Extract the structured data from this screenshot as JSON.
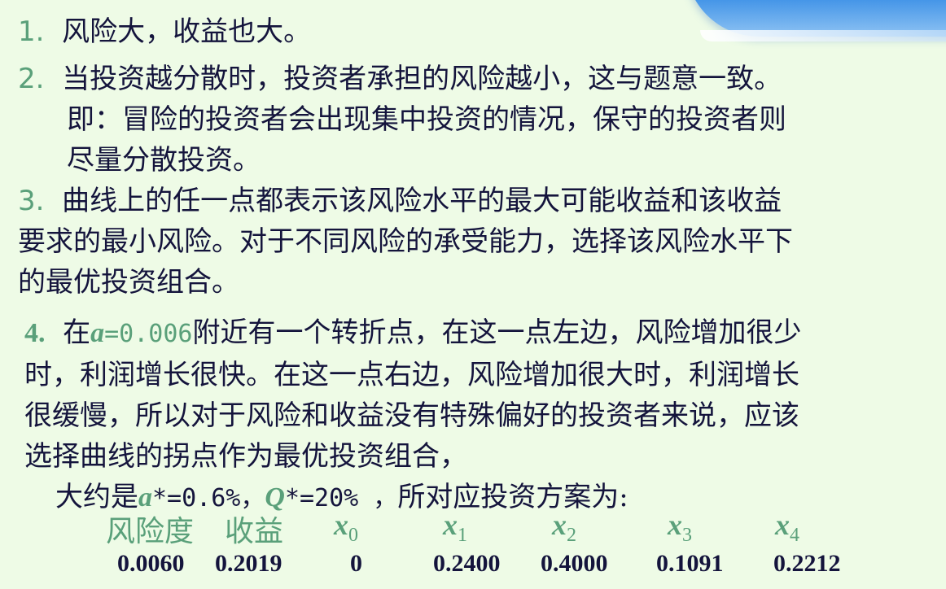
{
  "p1": {
    "num": "1.",
    "text": "风险大，收益也大。"
  },
  "p2": {
    "num": "2.",
    "line1": "当投资越分散时，投资者承担的风险越小，这与题意一致。",
    "line2": "即：冒险的投资者会出现集中投资的情况，保守的投资者则",
    "line3": "尽量分散投资。"
  },
  "p3": {
    "num": "3.",
    "line1": "曲线上的任一点都表示该风险水平的最大可能收益和该收益",
    "line2": "要求的最小风险。对于不同风险的承受能力，选择该风险水平下",
    "line3": "的最优投资组合。"
  },
  "p4": {
    "num": "4.",
    "pre": "在",
    "var_a": "a",
    "eq_val": "=0.006",
    "post1": "附近有一个转折点，在这一点左边，风险增加很少",
    "line2": "时，利润增长很快。在这一点右边，风险增加很大时，利润增长",
    "line3": "很缓慢，所以对于风险和收益没有特殊偏好的投资者来说，应该",
    "line4": "选择曲线的拐点作为最优投资组合，",
    "approx_pre": "大约是",
    "a_star_var": "a",
    "a_star_val": "*=0.6%，",
    "q_var": "Q",
    "q_val": "*=20% ，",
    "approx_post": "所对应投资方案为:"
  },
  "table": {
    "headers": [
      "风险度",
      "收益"
    ],
    "x_headers": [
      {
        "base": "x",
        "sub": "0"
      },
      {
        "base": "x",
        "sub": "1"
      },
      {
        "base": "x",
        "sub": "2"
      },
      {
        "base": "x",
        "sub": "3"
      },
      {
        "base": "x",
        "sub": "4"
      }
    ],
    "values": [
      "0.0060",
      "0.2019",
      "0",
      "0.2400",
      "0.4000",
      "0.1091",
      "0.2212"
    ]
  }
}
